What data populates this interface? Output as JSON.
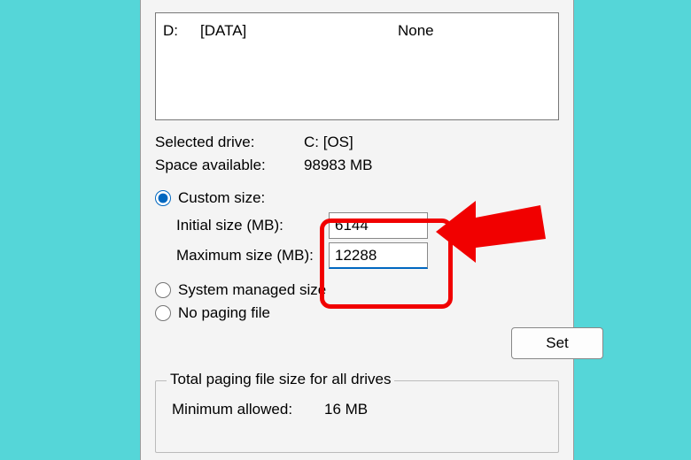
{
  "drives": {
    "rows": [
      {
        "letter": "D:",
        "label": "[DATA]",
        "status": "None"
      }
    ]
  },
  "selected_drive_label": "Selected drive:",
  "selected_drive_value": "C:  [OS]",
  "space_available_label": "Space available:",
  "space_available_value": "98983 MB",
  "radio_custom": "Custom size:",
  "initial_label": "Initial size (MB):",
  "initial_value": "6144",
  "max_label": "Maximum size (MB):",
  "max_value": "12288",
  "radio_system": "System managed size",
  "radio_none": "No paging file",
  "set_button": "Set",
  "total_group_title": "Total paging file size for all drives",
  "min_allowed_label": "Minimum allowed:",
  "min_allowed_value": "16 MB"
}
